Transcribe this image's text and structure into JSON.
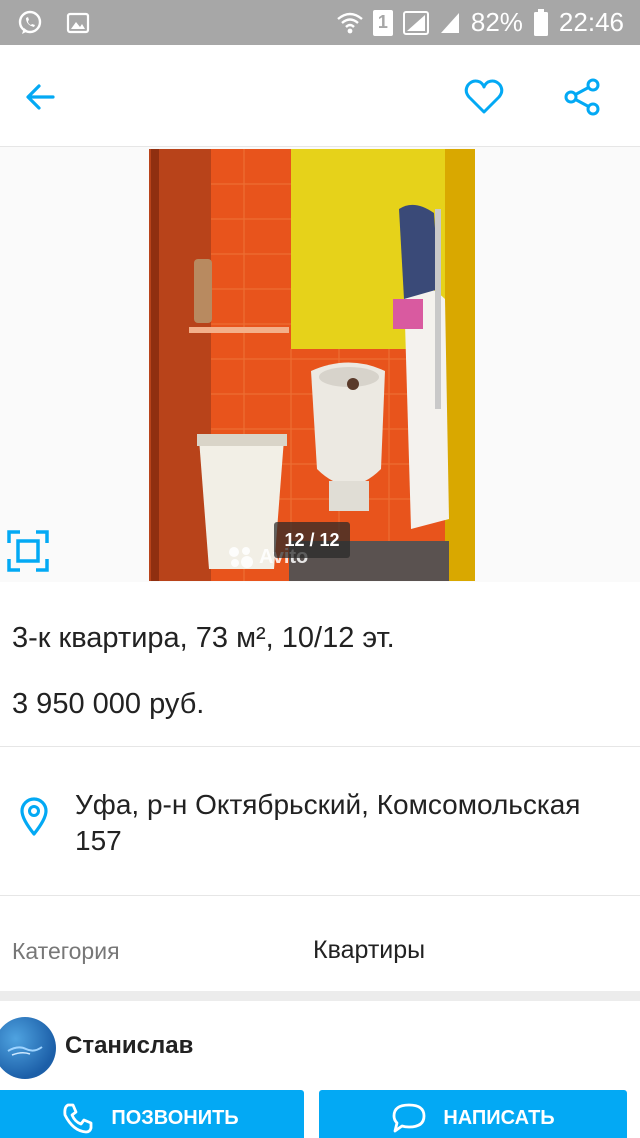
{
  "status_bar": {
    "battery": "82%",
    "time": "22:46",
    "sim_slot": "1",
    "icons": [
      "whatsapp-icon",
      "gallery-icon",
      "wifi-icon",
      "signal-icon",
      "battery-icon"
    ]
  },
  "app_bar": {
    "icons": [
      "back-arrow-icon",
      "heart-icon",
      "share-icon"
    ],
    "accent_color": "#03a9f4"
  },
  "gallery": {
    "counter": "12 / 12",
    "watermark": "Avito"
  },
  "ad": {
    "title": "3-к квартира, 73 м², 10/12 эт.",
    "price": "3 950 000 руб."
  },
  "address": {
    "text": "Уфа, р-н Октябрьский, Комсомольская 157"
  },
  "category": {
    "label": "Категория",
    "value": "Квартиры"
  },
  "seller": {
    "name": "Станислав"
  },
  "actions": {
    "call_label": "ПОЗВОНИТЬ",
    "message_label": "НАПИСАТЬ"
  }
}
